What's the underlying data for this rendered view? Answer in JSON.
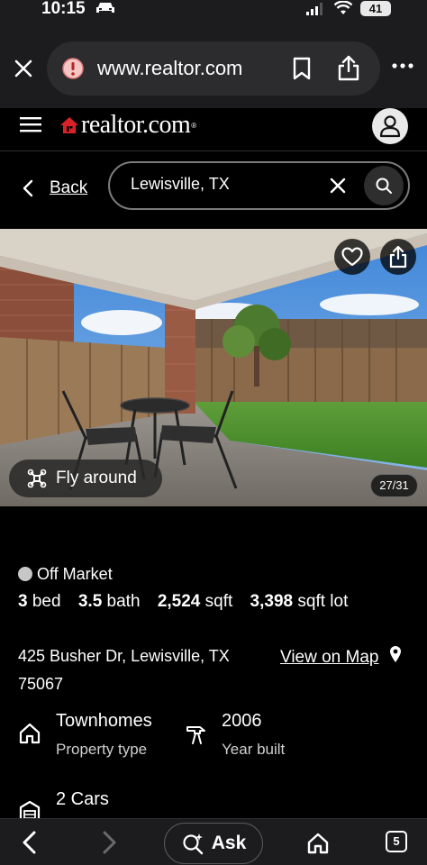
{
  "status_bar": {
    "time": "10:15",
    "battery": "41"
  },
  "browser": {
    "url": "www.realtor.com"
  },
  "site": {
    "brand": "realtor.com",
    "brand_mark": "®"
  },
  "search": {
    "back_label": "Back",
    "value": "Lewisville, TX"
  },
  "photo": {
    "fly_around_label": "Fly around",
    "counter": "27/31"
  },
  "listing": {
    "status": "Off Market",
    "beds": "3",
    "beds_unit": "bed",
    "baths": "3.5",
    "baths_unit": "bath",
    "sqft": "2,524",
    "sqft_unit": "sqft",
    "lot": "3,398",
    "lot_unit": "sqft lot",
    "address_line1": "425 Busher Dr, Lewisville, TX",
    "address_line2": "75067",
    "map_link": "View on Map",
    "features": [
      {
        "value": "Townhomes",
        "label": "Property type",
        "icon": "house-icon"
      },
      {
        "value": "2006",
        "label": "Year built",
        "icon": "hammer-icon"
      },
      {
        "value": "2 Cars",
        "label": "",
        "icon": "garage-icon"
      }
    ]
  },
  "toolbar": {
    "ask_label": "Ask",
    "tab_count": "5"
  }
}
